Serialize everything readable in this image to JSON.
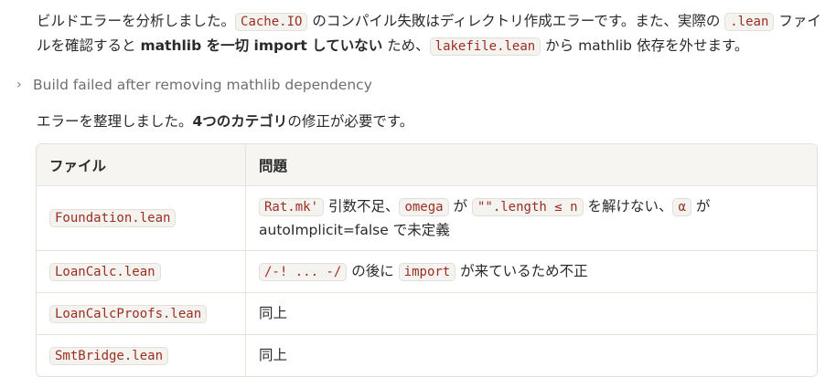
{
  "message": {
    "p1": {
      "t1": "ビルドエラーを分析しました。",
      "c1": "Cache.IO",
      "t2": " のコンパイル失敗はディレクトリ作成エラーです。また、実際の ",
      "c2": ".lean",
      "t3": " ファイルを確認すると ",
      "b1": "mathlib を一切 import していない",
      "t4": " ため、",
      "c3": "lakefile.lean",
      "t5": " から mathlib 依存を外せます。"
    },
    "collapsed_step": "Build failed after removing mathlib dependency",
    "p2": {
      "t1": "エラーを整理しました。",
      "b1": "4つのカテゴリ",
      "t2": "の修正が必要です。"
    }
  },
  "table": {
    "headers": [
      "ファイル",
      "問題"
    ],
    "rows": [
      {
        "file": "Foundation.lean",
        "c1": "Rat.mk'",
        "t1": " 引数不足、",
        "c2": "omega",
        "t2": " が ",
        "c3": "\"\".length ≤ n",
        "t3": " を解けない、",
        "c4": "α",
        "t4": " が autoImplicit=false で未定義"
      },
      {
        "file": "LoanCalc.lean",
        "c1": "/-! ... -/",
        "t1": " の後に ",
        "c2": "import",
        "t2": " が来ているため不正"
      },
      {
        "file": "LoanCalcProofs.lean",
        "issue": "同上"
      },
      {
        "file": "SmtBridge.lean",
        "issue": "同上"
      }
    ]
  }
}
